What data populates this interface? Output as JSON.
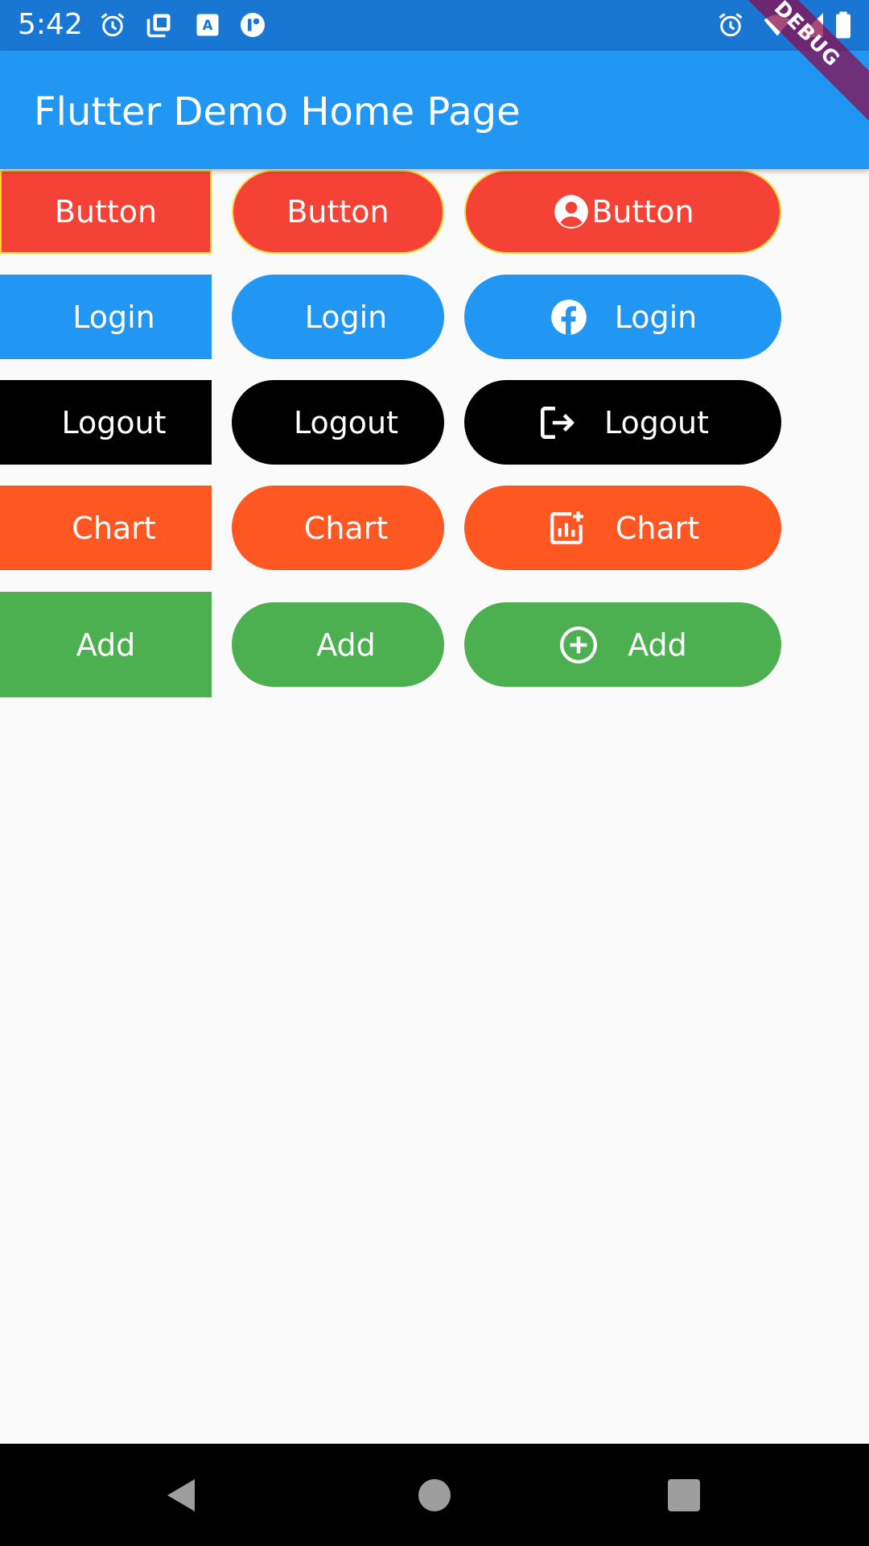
{
  "status_bar": {
    "time": "5:42"
  },
  "app_bar": {
    "title": "Flutter Demo Home Page"
  },
  "debug_banner": "DEBUG",
  "rows": [
    {
      "color": "#F44336",
      "square_label": "Button",
      "round_label": "Button",
      "icon_label": "Button",
      "icon": "account-circle-icon"
    },
    {
      "color": "#2196F3",
      "square_label": "Login",
      "round_label": "Login",
      "icon_label": "Login",
      "icon": "facebook-icon"
    },
    {
      "color": "#000000",
      "square_label": "Logout",
      "round_label": "Logout",
      "icon_label": "Logout",
      "icon": "logout-icon"
    },
    {
      "color": "#FF5722",
      "square_label": "Chart",
      "round_label": "Chart",
      "icon_label": "Chart",
      "icon": "add-chart-icon"
    },
    {
      "color": "#4CAF50",
      "square_label": "Add",
      "round_label": "Add",
      "icon_label": "Add",
      "icon": "add-circle-icon"
    }
  ],
  "colors": {
    "status_bar": "#1976D2",
    "app_bar": "#2196F3",
    "background": "#FAFAFA",
    "border_accent": "#FDD835"
  }
}
